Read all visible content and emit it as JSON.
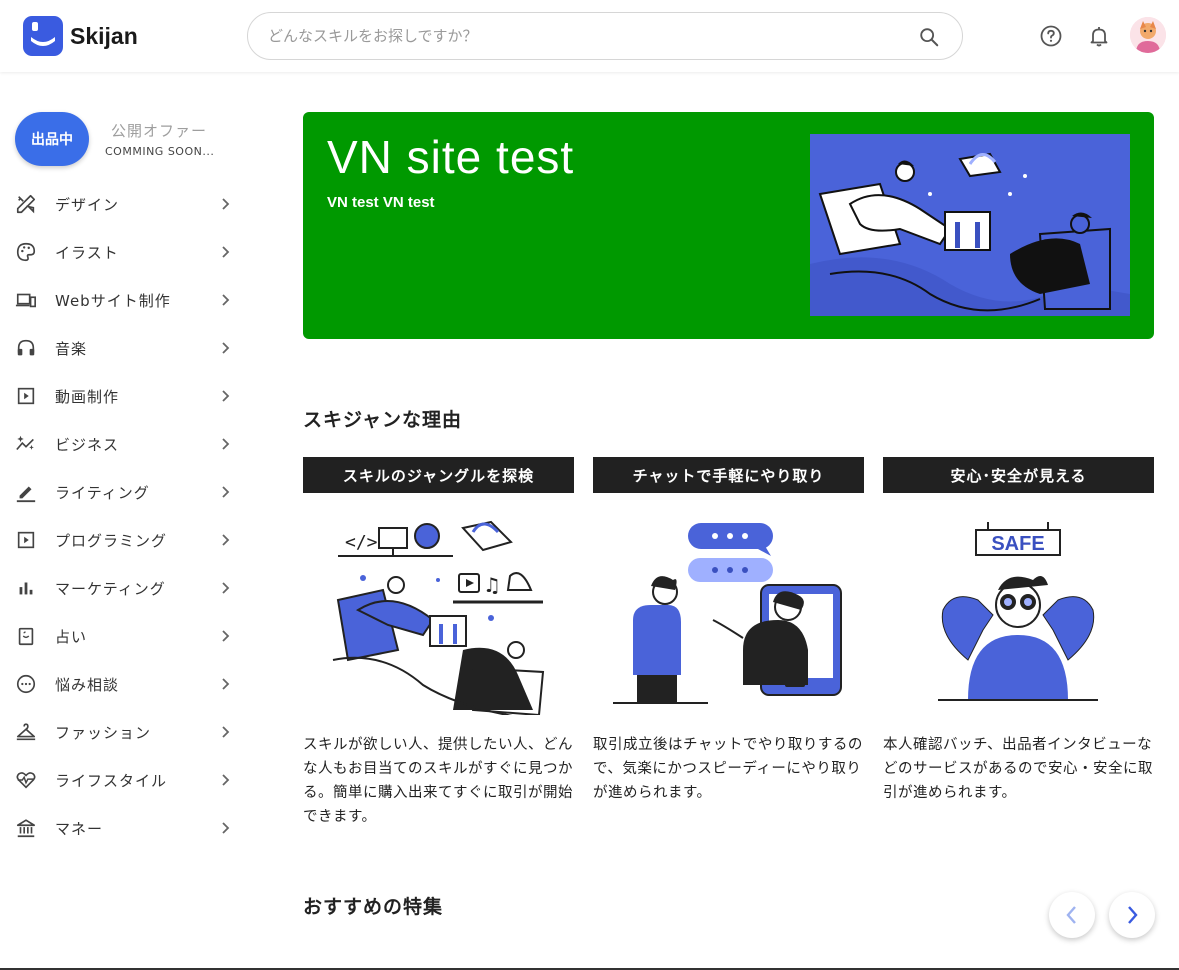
{
  "header": {
    "logo_text": "Skijan",
    "search_placeholder": "どんなスキルをお探しですか？",
    "icons": [
      "search-icon",
      "help-icon",
      "bell-icon",
      "avatar"
    ]
  },
  "sidebar": {
    "status_label": "出品中",
    "offer_label": "公開オファー",
    "soon_label": "COMMING SOON...",
    "items": [
      {
        "label": "デザイン",
        "icon": "design-tools-icon"
      },
      {
        "label": "イラスト",
        "icon": "palette-icon"
      },
      {
        "label": "Webサイト制作",
        "icon": "devices-icon"
      },
      {
        "label": "音楽",
        "icon": "headphones-icon"
      },
      {
        "label": "動画制作",
        "icon": "play-box-icon"
      },
      {
        "label": "ビジネス",
        "icon": "sparkle-chart-icon"
      },
      {
        "label": "ライティング",
        "icon": "pencil-icon"
      },
      {
        "label": "プログラミング",
        "icon": "play-box-icon"
      },
      {
        "label": "マーケティング",
        "icon": "bar-chart-icon"
      },
      {
        "label": "占い",
        "icon": "crystal-icon"
      },
      {
        "label": "悩み相談",
        "icon": "chat-dots-icon"
      },
      {
        "label": "ファッション",
        "icon": "hanger-icon"
      },
      {
        "label": "ライフスタイル",
        "icon": "heart-pulse-icon"
      },
      {
        "label": "マネー",
        "icon": "bank-icon"
      }
    ]
  },
  "banner": {
    "title": "VN site test",
    "subtitle": "VN test VN test",
    "bg_color": "#009900"
  },
  "reasons": {
    "title": "スキジャンな理由",
    "cards": [
      {
        "heading": "スキルのジャングルを探検",
        "text": "スキルが欲しい人、提供したい人、どんな人もお目当てのスキルがすぐに見つかる。簡単に購入出来てすぐに取引が開始できます。"
      },
      {
        "heading": "チャットで手軽にやり取り",
        "text": "取引成立後はチャットでやり取りするので、気楽にかつスピーディーにやり取りが進められます。"
      },
      {
        "heading": "安心･安全が見える",
        "text": "本人確認バッチ、出品者インタビューなどのサービスがあるので安心・安全に取引が進められます。",
        "sign": "SAFE"
      }
    ]
  },
  "featured": {
    "title": "おすすめの特集"
  },
  "colors": {
    "accent": "#3a6ee8",
    "illustration_blue": "#4a63d9",
    "dark": "#212121"
  }
}
